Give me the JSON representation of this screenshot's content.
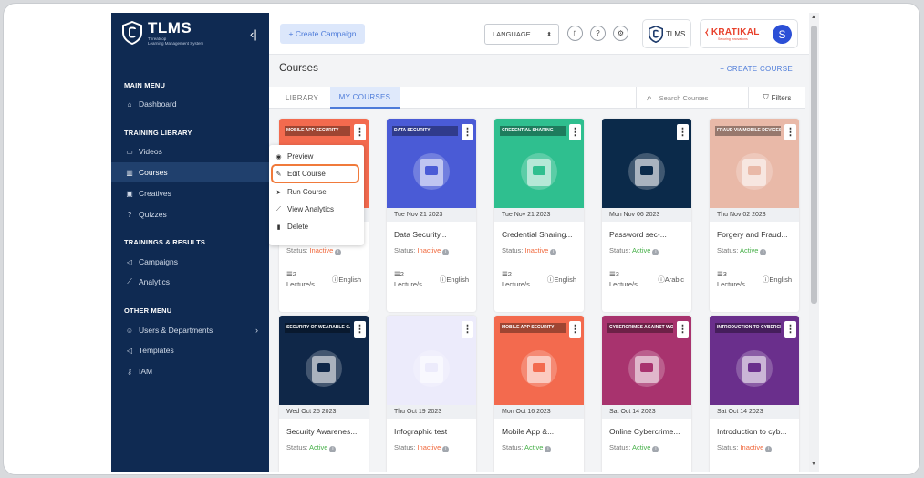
{
  "sidebar": {
    "logo": {
      "title": "TLMS",
      "subtitle": "Threatcop\nLearning Management System"
    },
    "collapse_icon": "collapse-icon",
    "sections": [
      {
        "label": "MAIN MENU",
        "items": [
          {
            "label": "Dashboard",
            "icon": "home-icon"
          }
        ]
      },
      {
        "label": "TRAINING LIBRARY",
        "items": [
          {
            "label": "Videos",
            "icon": "video-icon"
          },
          {
            "label": "Courses",
            "icon": "book-icon",
            "active": true
          },
          {
            "label": "Creatives",
            "icon": "image-icon"
          },
          {
            "label": "Quizzes",
            "icon": "question-icon"
          }
        ]
      },
      {
        "label": "TRAININGS & RESULTS",
        "items": [
          {
            "label": "Campaigns",
            "icon": "megaphone-icon"
          },
          {
            "label": "Analytics",
            "icon": "chart-icon"
          }
        ]
      },
      {
        "label": "OTHER MENU",
        "items": [
          {
            "label": "Users & Departments",
            "icon": "user-icon",
            "has_submenu": true
          },
          {
            "label": "Templates",
            "icon": "megaphone-icon"
          },
          {
            "label": "IAM",
            "icon": "key-icon"
          }
        ]
      }
    ]
  },
  "topbar": {
    "create_campaign": "+ Create Campaign",
    "language": "LANGUAGE",
    "org1": "TLMS",
    "org2": "KRATIKAL",
    "org2_sub": "Securing Innovations",
    "avatar": "S"
  },
  "courses": {
    "title": "Courses",
    "create_course": "+ CREATE COURSE",
    "tabs": [
      {
        "label": "LIBRARY"
      },
      {
        "label": "MY COURSES",
        "active": true
      }
    ],
    "search_placeholder": "Search Courses",
    "filters": "Filters"
  },
  "menu": {
    "items": [
      {
        "label": "Preview",
        "icon": "eye-icon"
      },
      {
        "label": "Edit Course",
        "icon": "edit-icon",
        "highlighted": true
      },
      {
        "label": "Run Course",
        "icon": "send-icon"
      },
      {
        "label": "View Analytics",
        "icon": "analytics-icon"
      },
      {
        "label": "Delete",
        "icon": "trash-icon"
      }
    ]
  },
  "cards": [
    {
      "banner": "MOBILE APP SECURITY",
      "date": "",
      "title": "",
      "status_label": "Status:",
      "status": "Inactive",
      "lectures": "2",
      "lecture_unit": "Lecture/s",
      "language": "English",
      "theme": "#f36a4e"
    },
    {
      "banner": "DATA SECURITY",
      "date": "Tue Nov 21 2023",
      "title": "Data Security...",
      "status_label": "Status:",
      "status": "Inactive",
      "lectures": "2",
      "lecture_unit": "Lecture/s",
      "language": "English",
      "theme": "#4a5bd6"
    },
    {
      "banner": "CREDENTIAL SHARING",
      "date": "Tue Nov 21 2023",
      "title": "Credential Sharing...",
      "status_label": "Status:",
      "status": "Inactive",
      "lectures": "2",
      "lecture_unit": "Lecture/s",
      "language": "English",
      "theme": "#2fbf8f"
    },
    {
      "banner": "",
      "date": "Mon Nov 06 2023",
      "title": "Password sec-...",
      "status_label": "Status:",
      "status": "Active",
      "lectures": "3",
      "lecture_unit": "Lecture/s",
      "language": "Arabic",
      "theme": "#0b2a4a"
    },
    {
      "banner": "FRAUD VIA MOBILE DEVICES",
      "date": "Thu Nov 02 2023",
      "title": "Forgery and Fraud...",
      "status_label": "Status:",
      "status": "Active",
      "lectures": "3",
      "lecture_unit": "Lecture/s",
      "language": "English",
      "theme": "#e9b9a8"
    },
    {
      "banner": "SECURITY OF WEARABLE GADG",
      "date": "Wed Oct 25 2023",
      "title": "Security Awarenes...",
      "status_label": "Status:",
      "status": "Active",
      "theme": "#0f2748"
    },
    {
      "banner": "",
      "date": "Thu Oct 19 2023",
      "title": "Infographic test",
      "status_label": "Status:",
      "status": "Inactive",
      "theme": "#ecebfb"
    },
    {
      "banner": "MOBILE APP SECURITY",
      "date": "Mon Oct 16 2023",
      "title": "Mobile App &...",
      "status_label": "Status:",
      "status": "Active",
      "theme": "#f36a4e"
    },
    {
      "banner": "CYBERCRIMES AGAINST WOM",
      "date": "Sat Oct 14 2023",
      "title": "Online Cybercrime...",
      "status_label": "Status:",
      "status": "Active",
      "theme": "#a8336e"
    },
    {
      "banner": "INTRODUCTION TO CYBERCR",
      "date": "Sat Oct 14 2023",
      "title": "Introduction to cyb...",
      "status_label": "Status:",
      "status": "Inactive",
      "theme": "#6a2f8c"
    }
  ]
}
